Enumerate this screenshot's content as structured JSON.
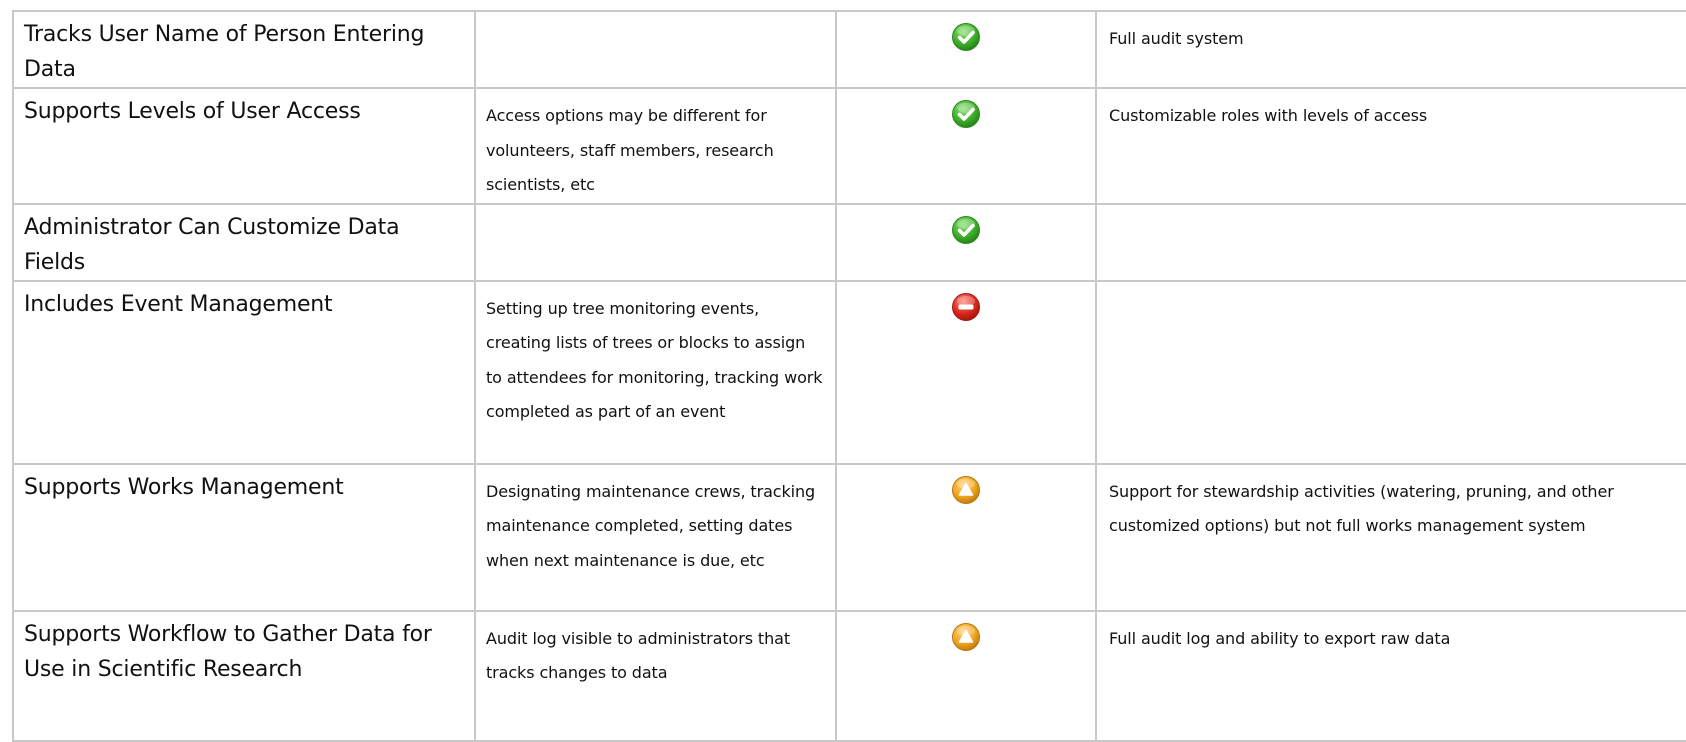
{
  "rows": [
    {
      "feature": "Tracks User Name of Person Entering Data",
      "description": "",
      "status": "supported",
      "status_icon": "green-check-icon",
      "notes": "Full audit system"
    },
    {
      "feature": "Supports Levels of User Access",
      "description": "Access options may be different for volunteers, staff members, research scientists, etc",
      "status": "supported",
      "status_icon": "green-check-icon",
      "notes": "Customizable roles with levels of access"
    },
    {
      "feature": "Administrator Can Customize Data Fields",
      "description": "",
      "status": "supported",
      "status_icon": "green-check-icon",
      "notes": ""
    },
    {
      "feature": "Includes Event Management",
      "description": "Setting up tree monitoring events, creating lists of trees or blocks to assign to attendees for monitoring, tracking work completed as part of an event",
      "status": "not-supported",
      "status_icon": "red-minus-icon",
      "notes": ""
    },
    {
      "feature": "Supports Works Management",
      "description": "Designating maintenance crews, tracking maintenance completed, setting dates when next maintenance is due, etc",
      "status": "partial",
      "status_icon": "orange-triangle-icon",
      "notes": "Support for stewardship activities (watering, pruning, and other customized options) but not full works management system"
    },
    {
      "feature": "Supports Workflow to Gather Data for Use in Scientific Research",
      "description": "Audit log visible to administrators that tracks changes to data",
      "status": "partial",
      "status_icon": "orange-triangle-icon",
      "notes": "Full audit log and ability to export raw data"
    }
  ],
  "colors": {
    "border": "#c8c8c8",
    "supported": "#3fae2a",
    "not_supported": "#d9261c",
    "partial": "#f0a41e"
  }
}
